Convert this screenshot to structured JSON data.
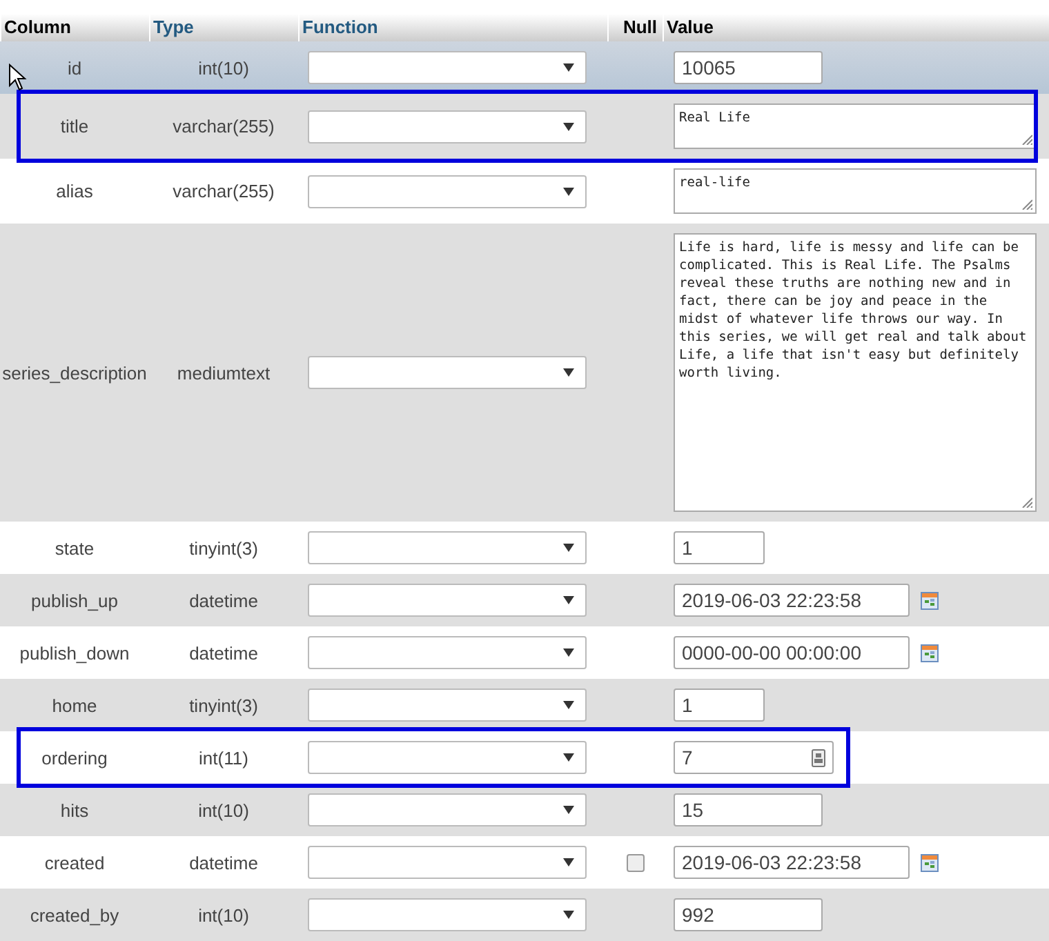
{
  "columns": [
    {
      "label": "Column",
      "link": false
    },
    {
      "label": "Type",
      "link": true
    },
    {
      "label": "Function",
      "link": true
    },
    {
      "label": "Null",
      "link": false
    },
    {
      "label": "Value",
      "link": false
    }
  ],
  "rows": [
    {
      "name": "id",
      "type": "int(10)",
      "hovered": true,
      "outlined": false,
      "kind": "input",
      "value": "10065"
    },
    {
      "name": "title",
      "type": "varchar(255)",
      "hovered": false,
      "outlined": true,
      "kind": "textarea",
      "value": "Real Life"
    },
    {
      "name": "alias",
      "type": "varchar(255)",
      "hovered": false,
      "outlined": false,
      "kind": "textarea",
      "value": "real-life"
    },
    {
      "name": "series_description",
      "type": "mediumtext",
      "hovered": false,
      "outlined": false,
      "kind": "tall-textarea",
      "value": "Life is hard, life is messy and life can be complicated. This is Real Life. The Psalms reveal these truths are nothing new and in fact, there can be joy and peace in the midst of whatever life throws our way. In this series, we will get real and talk about Life, a life that isn't easy but definitely worth living."
    },
    {
      "name": "state",
      "type": "tinyint(3)",
      "hovered": false,
      "outlined": false,
      "kind": "short-input",
      "value": "1"
    },
    {
      "name": "publish_up",
      "type": "datetime",
      "hovered": false,
      "outlined": false,
      "kind": "datetime",
      "value": "2019-06-03 22:23:58"
    },
    {
      "name": "publish_down",
      "type": "datetime",
      "hovered": false,
      "outlined": false,
      "kind": "datetime",
      "value": "0000-00-00 00:00:00"
    },
    {
      "name": "home",
      "type": "tinyint(3)",
      "hovered": false,
      "outlined": false,
      "kind": "short-input",
      "value": "1"
    },
    {
      "name": "ordering",
      "type": "int(11)",
      "hovered": false,
      "outlined": true,
      "kind": "number",
      "value": "7"
    },
    {
      "name": "hits",
      "type": "int(10)",
      "hovered": false,
      "outlined": false,
      "kind": "input",
      "value": "15"
    },
    {
      "name": "created",
      "type": "datetime",
      "hovered": false,
      "outlined": false,
      "kind": "datetime",
      "value": "2019-06-03 22:23:58",
      "null_checkbox": {
        "checked": false
      }
    },
    {
      "name": "created_by",
      "type": "int(10)",
      "hovered": false,
      "outlined": false,
      "kind": "input",
      "value": "992"
    }
  ]
}
